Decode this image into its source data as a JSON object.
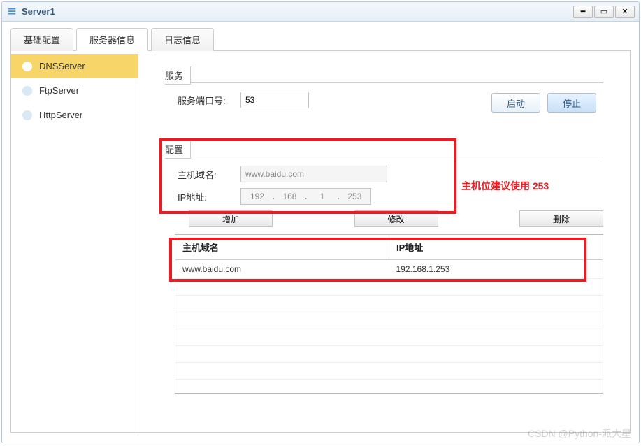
{
  "window": {
    "title": "Server1"
  },
  "tabs": {
    "items": [
      {
        "label": "基础配置"
      },
      {
        "label": "服务器信息"
      },
      {
        "label": "日志信息"
      }
    ],
    "active_index": 1
  },
  "sidebar": {
    "items": [
      {
        "label": "DNSServer"
      },
      {
        "label": "FtpServer"
      },
      {
        "label": "HttpServer"
      }
    ],
    "active_index": 0
  },
  "service_section": {
    "legend": "服务",
    "port_label": "服务端口号:",
    "port_value": "53",
    "start_btn": "启动",
    "stop_btn": "停止"
  },
  "config_section": {
    "legend": "配置",
    "hostname_label": "主机域名:",
    "hostname_value": "www.baidu.com",
    "ip_label": "IP地址:",
    "ip_segments": [
      "192",
      "168",
      "1",
      "253"
    ],
    "add_btn": "增加",
    "modify_btn": "修改",
    "delete_btn": "删除"
  },
  "table": {
    "headers": {
      "hostname": "主机域名",
      "ip": "IP地址"
    },
    "rows": [
      {
        "hostname": "www.baidu.com",
        "ip": "192.168.1.253"
      }
    ]
  },
  "annotation": {
    "hint": "主机位建议使用 253"
  },
  "watermark": "CSDN @Python-派大星"
}
